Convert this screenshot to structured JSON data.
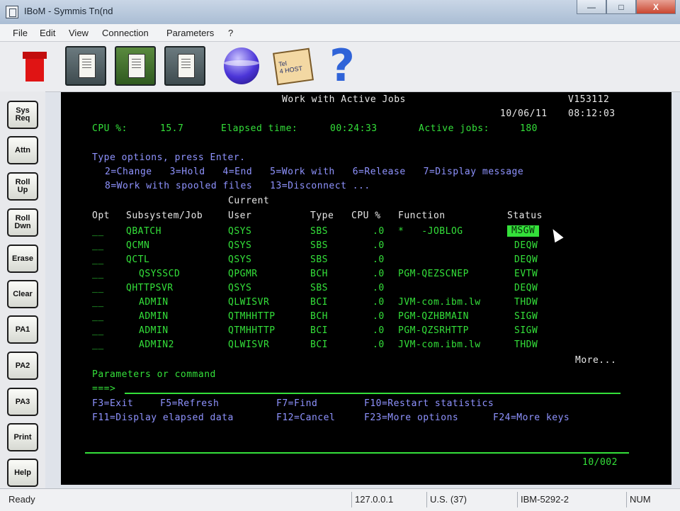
{
  "window": {
    "title": "IBoM - Symmis Tn(nd",
    "controls": {
      "minimize": "—",
      "maximize": "□",
      "close": "X"
    }
  },
  "menu": [
    "File",
    "Edit",
    "View",
    "Connection",
    "Parameters",
    "?"
  ],
  "toolbar": {
    "icons": [
      "stop-icon",
      "copy-screen-icon",
      "paste-screen-icon",
      "print-screen-icon",
      "connect-globe-icon",
      "telnet-screen-icon",
      "help-icon"
    ],
    "help_glyph": "?"
  },
  "sidebar": [
    "Sys\nReq",
    "Attn",
    "Roll\nUp",
    "Roll\nDwn",
    "Erase",
    "Clear",
    "PA1",
    "PA2",
    "PA3",
    "Print",
    "Help"
  ],
  "terminal": {
    "title": "Work with Active Jobs",
    "system": "V153112",
    "date": "10/06/11",
    "time": "08:12:03",
    "cpu_label": "CPU %:",
    "cpu_value": "15.7",
    "elapsed_label": "Elapsed time:",
    "elapsed_value": "00:24:33",
    "active_label": "Active jobs:",
    "active_value": "180",
    "instructions": "Type options, press Enter.",
    "options_line1": "2=Change   3=Hold   4=End   5=Work with   6=Release   7=Display message",
    "options_line2": "8=Work with spooled files   13=Disconnect ...",
    "col_current": "Current",
    "col_opt": "Opt",
    "col_subsystem": "Subsystem/Job",
    "col_user": "User",
    "col_type": "Type",
    "col_cpu": "CPU %",
    "col_function": "Function",
    "col_status": "Status",
    "rows": [
      {
        "job": "QBATCH",
        "user": "QSYS",
        "type": "SBS",
        "cpu": ".0",
        "function": "*   -JOBLOG",
        "status": "MSGW"
      },
      {
        "job": "QCMN",
        "user": "QSYS",
        "type": "SBS",
        "cpu": ".0",
        "function": "",
        "status": "DEQW"
      },
      {
        "job": "QCTL",
        "user": "QSYS",
        "type": "SBS",
        "cpu": ".0",
        "function": "",
        "status": "DEQW"
      },
      {
        "job": "QSYSSCD",
        "user": "QPGMR",
        "type": "BCH",
        "cpu": ".0",
        "function": "PGM-QEZSCNEP",
        "status": "EVTW"
      },
      {
        "job": "QHTTPSVR",
        "user": "QSYS",
        "type": "SBS",
        "cpu": ".0",
        "function": "",
        "status": "DEQW"
      },
      {
        "job": "ADMIN",
        "user": "QLWISVR",
        "type": "BCI",
        "cpu": ".0",
        "function": "JVM-com.ibm.lw",
        "status": "THDW"
      },
      {
        "job": "ADMIN",
        "user": "QTMHHTTP",
        "type": "BCH",
        "cpu": ".0",
        "function": "PGM-QZHBMAIN",
        "status": "SIGW"
      },
      {
        "job": "ADMIN",
        "user": "QTMHHTTP",
        "type": "BCI",
        "cpu": ".0",
        "function": "PGM-QZSRHTTP",
        "status": "SIGW"
      },
      {
        "job": "ADMIN2",
        "user": "QLWISVR",
        "type": "BCI",
        "cpu": ".0",
        "function": "JVM-com.ibm.lw",
        "status": "THDW"
      }
    ],
    "more": "More...",
    "params_label": "Parameters or command",
    "prompt": "===>",
    "fkeys_line1": [
      "F3=Exit",
      "F5=Refresh",
      "F7=Find",
      "F10=Restart statistics"
    ],
    "fkeys_line2": [
      "F11=Display elapsed data",
      "F12=Cancel",
      "F23=More options",
      "F24=More keys"
    ],
    "position": "10/002"
  },
  "statusbar": {
    "ready": "Ready",
    "ip": "127.0.0.1",
    "keyboard": "U.S. (37)",
    "terminal_type": "IBM-5292-2",
    "num": "NUM"
  }
}
